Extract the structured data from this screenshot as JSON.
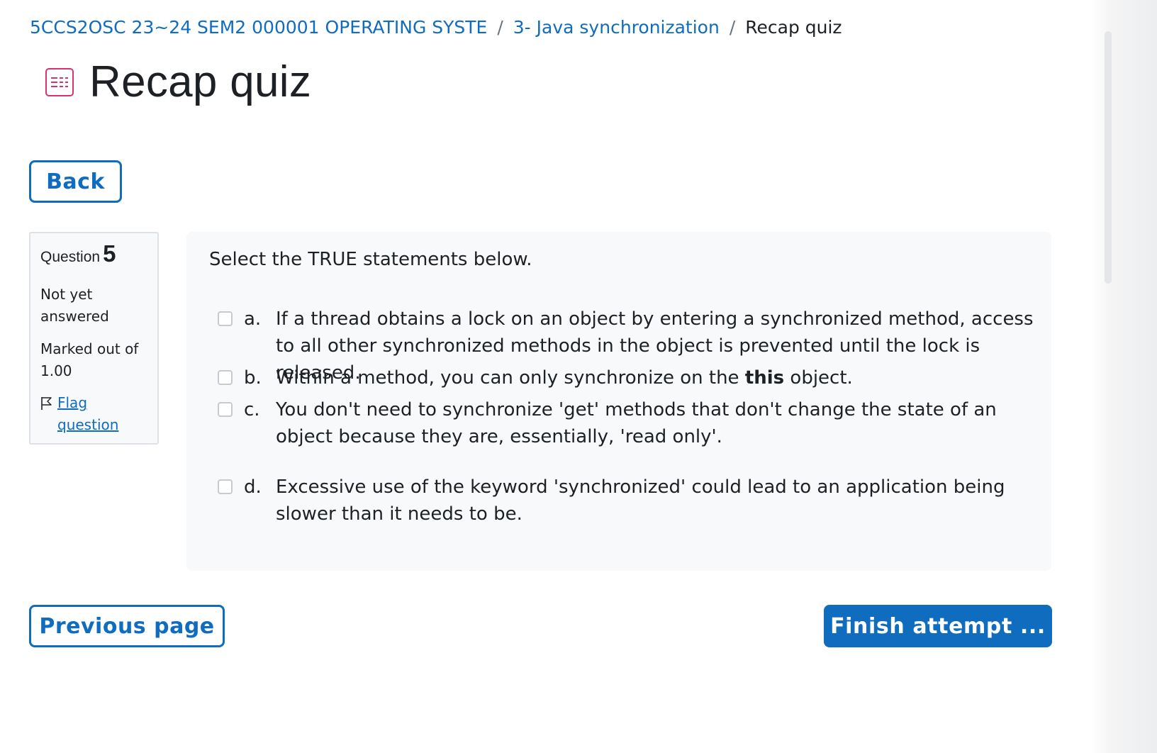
{
  "breadcrumb": {
    "course": "5CCS2OSC 23~24 SEM2 000001 OPERATING SYSTE",
    "separator": "/",
    "section": "3- Java synchronization",
    "current": "Recap quiz"
  },
  "page": {
    "title": "Recap quiz",
    "icon": "quiz-icon",
    "accent_color": "#d6336c"
  },
  "buttons": {
    "back": "Back",
    "previous_page": "Previous page",
    "finish_attempt": "Finish attempt ..."
  },
  "question_info": {
    "label": "Question",
    "number": "5",
    "state": "Not yet answered",
    "grade": "Marked out of 1.00",
    "flag_label": "Flag question"
  },
  "question": {
    "text": "Select the TRUE statements below.",
    "options": [
      {
        "letter": "a.",
        "text": "If a thread obtains a lock on an object by entering a synchronized method, access to all other synchronized methods in the object is prevented until the lock is released.",
        "checked": false
      },
      {
        "letter": "b.",
        "text_before": "Within a method, you can only synchronize on the ",
        "text_bold": "this",
        "text_after": " object.",
        "checked": false
      },
      {
        "letter": "c.",
        "text": "You don't need to synchronize 'get' methods that don't change the state of an object because they are, essentially, 'read only'.",
        "checked": false
      },
      {
        "letter": "d.",
        "text": "Excessive use of the keyword 'synchronized' could lead to an application being slower than it needs to be.",
        "checked": false
      }
    ]
  },
  "colors": {
    "primary": "#0f6cbf",
    "text": "#1d2125",
    "panel_bg": "#f8f9fa"
  }
}
